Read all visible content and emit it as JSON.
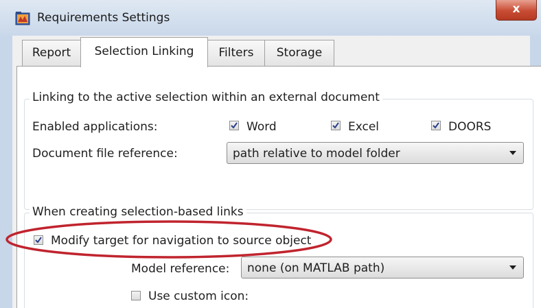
{
  "window": {
    "title": "Requirements Settings",
    "close_glyph": "x"
  },
  "icons": {
    "app": "simulink-icon",
    "close": "close-icon"
  },
  "tabs": [
    {
      "label": "Report",
      "active": false
    },
    {
      "label": "Selection Linking",
      "active": true
    },
    {
      "label": "Filters",
      "active": false
    },
    {
      "label": "Storage",
      "active": false
    }
  ],
  "external_group": {
    "legend": "Linking to the active selection within an external document",
    "enabled_apps_label": "Enabled applications:",
    "apps": [
      {
        "label": "Word",
        "checked": true
      },
      {
        "label": "Excel",
        "checked": true
      },
      {
        "label": "DOORS",
        "checked": true
      }
    ],
    "doc_ref_label": "Document file reference:",
    "doc_ref_value": "path relative to model folder"
  },
  "selection_group": {
    "legend": "When creating selection-based links",
    "modify_target_label": "Modify target for navigation to source object",
    "modify_target_checked": true,
    "model_ref_label": "Model reference:",
    "model_ref_value": "none (on MATLAB path)",
    "custom_icon_label": "Use custom icon:",
    "custom_icon_checked": false
  },
  "annotation": {
    "highlight_color": "#c0242e"
  }
}
